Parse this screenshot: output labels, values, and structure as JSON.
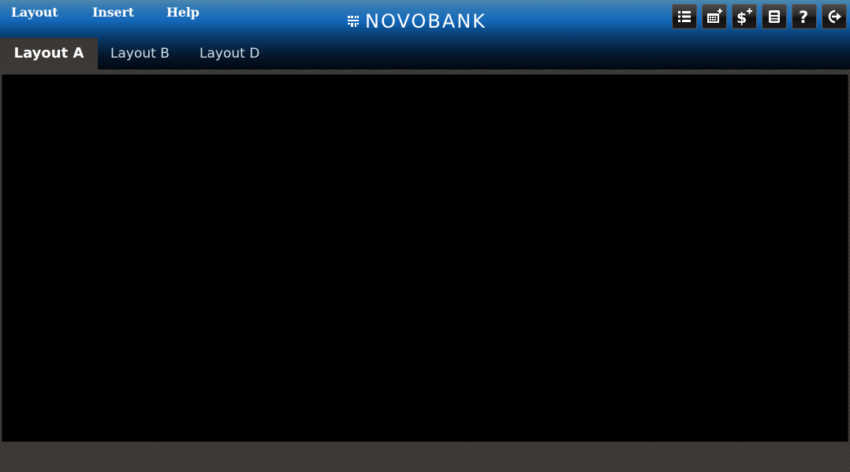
{
  "menu": {
    "items": [
      {
        "label": "Layout"
      },
      {
        "label": "Insert"
      },
      {
        "label": "Help"
      }
    ]
  },
  "brand": {
    "name": "NOVOBANK",
    "icon": "brand-logo-icon"
  },
  "toolbar": {
    "buttons": [
      {
        "icon": "list-icon"
      },
      {
        "icon": "add-widget-icon"
      },
      {
        "icon": "add-dollar-icon"
      },
      {
        "icon": "save-icon"
      },
      {
        "icon": "help-icon",
        "glyph": "?"
      },
      {
        "icon": "logout-icon"
      }
    ]
  },
  "tabs": [
    {
      "label": "Layout A",
      "active": true
    },
    {
      "label": "Layout B",
      "active": false
    },
    {
      "label": "Layout D",
      "active": false
    }
  ],
  "colors": {
    "header_blue": "#1468ba",
    "background": "#3b3835",
    "canvas": "#000000"
  }
}
